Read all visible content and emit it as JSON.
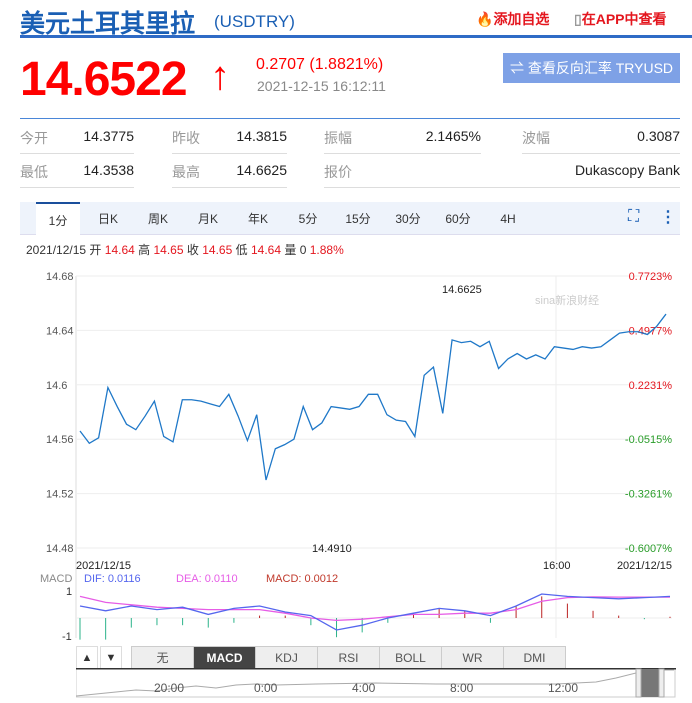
{
  "header": {
    "title": "美元土耳其里拉",
    "code": "(USDTRY)",
    "add_watch": "添加自选",
    "view_app": "在APP中查看"
  },
  "quote": {
    "price": "14.6522",
    "arrow": "↑",
    "change": "0.2707 (1.8821%)",
    "time": "2021-12-15 16:12:11",
    "reverse_button": "⇌ 查看反向汇率 TRYUSD"
  },
  "stats": [
    {
      "label": "今开",
      "value": "14.3775"
    },
    {
      "label": "昨收",
      "value": "14.3815"
    },
    {
      "label": "振幅",
      "value": "2.1465%"
    },
    {
      "label": "波幅",
      "value": "0.3087"
    },
    {
      "label": "最低",
      "value": "14.3538"
    },
    {
      "label": "最高",
      "value": "14.6625"
    },
    {
      "label": "报价",
      "value": "Dukascopy Bank"
    }
  ],
  "tabs": [
    "1分",
    "日K",
    "周K",
    "月K",
    "年K",
    "5分",
    "15分",
    "30分",
    "60分",
    "4H"
  ],
  "ohlc": {
    "date": "2021/12/15",
    "open_l": "开",
    "open": "14.64",
    "high_l": "高",
    "high": "14.65",
    "close_l": "收",
    "close": "14.65",
    "low_l": "低",
    "low": "14.64",
    "vol_l": "量",
    "vol": "0",
    "pct": "1.88%"
  },
  "indicator_tabs": [
    "无",
    "MACD",
    "KDJ",
    "RSI",
    "BOLL",
    "WR",
    "DMI"
  ],
  "chart_data": {
    "type": "line",
    "ylim": [
      14.48,
      14.68
    ],
    "y_ticks": [
      "14.68",
      "14.64",
      "14.6",
      "14.56",
      "14.52",
      "14.48"
    ],
    "right_ticks": [
      "0.7723%",
      "0.4977%",
      "0.2231%",
      "-0.0515%",
      "-0.3261%",
      "-0.6007%"
    ],
    "x_labels": [
      "2021/12/15",
      "16:00",
      "2021/12/15"
    ],
    "max_label": "14.6625",
    "min_label": "14.4910",
    "values": [
      14.566,
      14.557,
      14.561,
      14.598,
      14.584,
      14.571,
      14.567,
      14.577,
      14.588,
      14.562,
      14.558,
      14.589,
      14.589,
      14.588,
      14.586,
      14.584,
      14.593,
      14.577,
      14.559,
      14.578,
      14.53,
      14.553,
      14.556,
      14.56,
      14.584,
      14.567,
      14.572,
      14.584,
      14.583,
      14.582,
      14.584,
      14.593,
      14.593,
      14.578,
      14.574,
      14.573,
      14.562,
      14.607,
      14.613,
      14.579,
      14.633,
      14.631,
      14.632,
      14.628,
      14.632,
      14.612,
      14.619,
      14.623,
      14.619,
      14.622,
      14.619,
      14.628,
      14.627,
      14.626,
      14.628,
      14.627,
      14.628,
      14.633,
      14.638,
      14.639,
      14.639,
      14.637,
      14.643,
      14.652
    ]
  },
  "macd": {
    "label": "MACD",
    "dif": "DIF: 0.0116",
    "dea": "DEA: 0.0110",
    "macd": "MACD: 0.0012",
    "top": "1",
    "bottom": "-1",
    "dif_vals": [
      0.5,
      0.3,
      0.5,
      0.35,
      0.45,
      0.15,
      0.4,
      0.5,
      0.25,
      0.1,
      -0.5,
      -0.3,
      0,
      0.2,
      0.4,
      0.3,
      0.1,
      0.5,
      1.0,
      0.9,
      0.85,
      0.8,
      0.85,
      0.9
    ],
    "dea_vals": [
      0.9,
      0.65,
      0.55,
      0.45,
      0.4,
      0.35,
      0.35,
      0.35,
      0.2,
      0.0,
      -0.1,
      -0.05,
      0.05,
      0.15,
      0.15,
      0.2,
      0.2,
      0.35,
      0.7,
      0.85,
      0.88,
      0.87,
      0.87,
      0.87
    ],
    "hist_vals": [
      -0.9,
      -0.9,
      -0.4,
      -0.3,
      -0.3,
      -0.4,
      -0.2,
      0.1,
      0.1,
      -0.3,
      -0.8,
      -0.6,
      -0.2,
      0.2,
      0.4,
      0.3,
      -0.2,
      0.5,
      0.9,
      0.6,
      0.3,
      0.1,
      -0.05,
      0.05
    ]
  },
  "navigator": {
    "labels": [
      "20:00",
      "0:00",
      "4:00",
      "8:00",
      "12:00"
    ]
  }
}
